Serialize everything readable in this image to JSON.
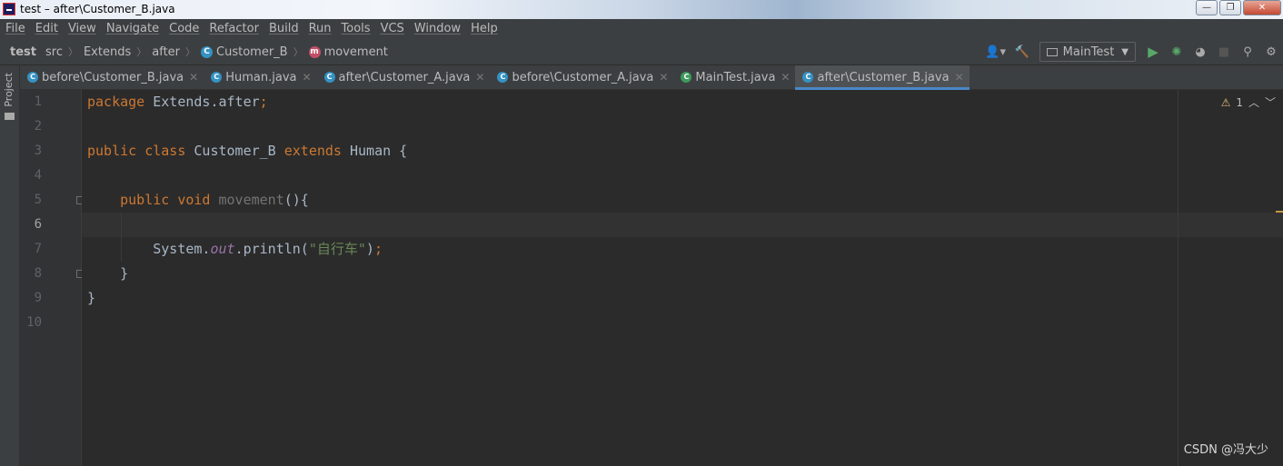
{
  "window": {
    "title": "test – after\\Customer_B.java"
  },
  "menu": [
    "File",
    "Edit",
    "View",
    "Navigate",
    "Code",
    "Refactor",
    "Build",
    "Run",
    "Tools",
    "VCS",
    "Window",
    "Help"
  ],
  "breadcrumb": {
    "project": "test",
    "src": "src",
    "pkg1": "Extends",
    "pkg2": "after",
    "class": "Customer_B",
    "method": "movement"
  },
  "toolbar": {
    "run_config": "MainTest"
  },
  "toolstrip": {
    "project_label": "Project"
  },
  "tabs": [
    {
      "label": "before\\Customer_B.java",
      "active": false
    },
    {
      "label": "Human.java",
      "active": false
    },
    {
      "label": "after\\Customer_A.java",
      "active": false
    },
    {
      "label": "before\\Customer_A.java",
      "active": false
    },
    {
      "label": "MainTest.java",
      "active": false
    },
    {
      "label": "after\\Customer_B.java",
      "active": true
    }
  ],
  "editor": {
    "line_numbers": [
      "1",
      "2",
      "3",
      "4",
      "5",
      "6",
      "7",
      "8",
      "9",
      "10"
    ],
    "warnings_count": "1",
    "code": {
      "l1_kw": "package",
      "l1_rest": " Extends.after",
      "l1_semi": ";",
      "l3_kw1": "public",
      "l3_kw2": "class",
      "l3_name": " Customer_B ",
      "l3_kw3": "extends",
      "l3_rest": " Human {",
      "l5_kw1": "public",
      "l5_kw2": "void",
      "l5_name": "movement",
      "l5_rest": "(){",
      "l7_a": "System.",
      "l7_field": "out",
      "l7_b": ".println(",
      "l7_str": "\"自行车\"",
      "l7_c": ")",
      "l7_semi": ";",
      "l8": "}",
      "l9": "}"
    }
  },
  "watermark": "CSDN @冯大少"
}
